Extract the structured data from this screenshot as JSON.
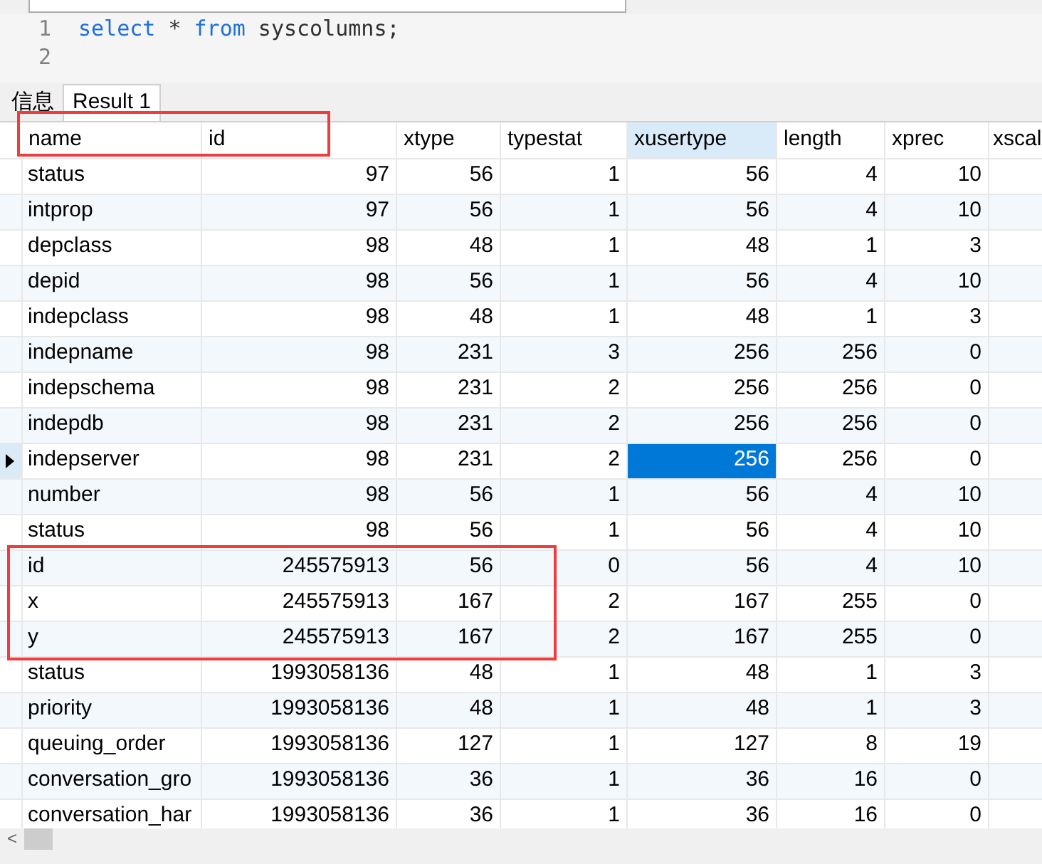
{
  "editor": {
    "lines": [
      {
        "number": "1",
        "tokens": [
          {
            "kind": "keyword",
            "text": "select"
          },
          {
            "kind": "plain",
            "text": " * "
          },
          {
            "kind": "keyword",
            "text": "from"
          },
          {
            "kind": "plain",
            "text": " syscolumns;"
          }
        ]
      },
      {
        "number": "2"
      }
    ]
  },
  "result_tabs": [
    {
      "label": "信息",
      "selected": false
    },
    {
      "label": "Result 1",
      "selected": true
    }
  ],
  "table": {
    "columns": [
      {
        "label": "name",
        "selected": false
      },
      {
        "label": "id",
        "selected": false
      },
      {
        "label": "xtype",
        "selected": false
      },
      {
        "label": "typestat",
        "selected": false
      },
      {
        "label": "xusertype",
        "selected": true
      },
      {
        "label": "length",
        "selected": false
      },
      {
        "label": "xprec",
        "selected": false
      },
      {
        "label": "xscal",
        "selected": false
      }
    ],
    "rows": [
      {
        "cells": [
          "status",
          "97",
          "56",
          "1",
          "56",
          "4",
          "10"
        ],
        "selected": false
      },
      {
        "cells": [
          "intprop",
          "97",
          "56",
          "1",
          "56",
          "4",
          "10"
        ],
        "selected": false
      },
      {
        "cells": [
          "depclass",
          "98",
          "48",
          "1",
          "48",
          "1",
          "3"
        ],
        "selected": false
      },
      {
        "cells": [
          "depid",
          "98",
          "56",
          "1",
          "56",
          "4",
          "10"
        ],
        "selected": false
      },
      {
        "cells": [
          "indepclass",
          "98",
          "48",
          "1",
          "48",
          "1",
          "3"
        ],
        "selected": false
      },
      {
        "cells": [
          "indepname",
          "98",
          "231",
          "3",
          "256",
          "256",
          "0"
        ],
        "selected": false
      },
      {
        "cells": [
          "indepschema",
          "98",
          "231",
          "2",
          "256",
          "256",
          "0"
        ],
        "selected": false
      },
      {
        "cells": [
          "indepdb",
          "98",
          "231",
          "2",
          "256",
          "256",
          "0"
        ],
        "selected": false
      },
      {
        "cells": [
          "indepserver",
          "98",
          "231",
          "2",
          "256",
          "256",
          "0"
        ],
        "selected": true
      },
      {
        "cells": [
          "number",
          "98",
          "56",
          "1",
          "56",
          "4",
          "10"
        ],
        "selected": false
      },
      {
        "cells": [
          "status",
          "98",
          "56",
          "1",
          "56",
          "4",
          "10"
        ],
        "selected": false
      },
      {
        "cells": [
          "id",
          "245575913",
          "56",
          "0",
          "56",
          "4",
          "10"
        ],
        "selected": false
      },
      {
        "cells": [
          "x",
          "245575913",
          "167",
          "2",
          "167",
          "255",
          "0"
        ],
        "selected": false
      },
      {
        "cells": [
          "y",
          "245575913",
          "167",
          "2",
          "167",
          "255",
          "0"
        ],
        "selected": false
      },
      {
        "cells": [
          "status",
          "1993058136",
          "48",
          "1",
          "48",
          "1",
          "3"
        ],
        "selected": false
      },
      {
        "cells": [
          "priority",
          "1993058136",
          "48",
          "1",
          "48",
          "1",
          "3"
        ],
        "selected": false
      },
      {
        "cells": [
          "queuing_order",
          "1993058136",
          "127",
          "1",
          "127",
          "8",
          "19"
        ],
        "selected": false
      },
      {
        "cells": [
          "conversation_gro",
          "1993058136",
          "36",
          "1",
          "36",
          "16",
          "0"
        ],
        "selected": false
      },
      {
        "cells": [
          "conversation_har",
          "1993058136",
          "36",
          "1",
          "36",
          "16",
          "0"
        ],
        "selected": false
      }
    ]
  },
  "annotations": {
    "header_box": true,
    "rows_box": true
  },
  "scroll_left": "<"
}
